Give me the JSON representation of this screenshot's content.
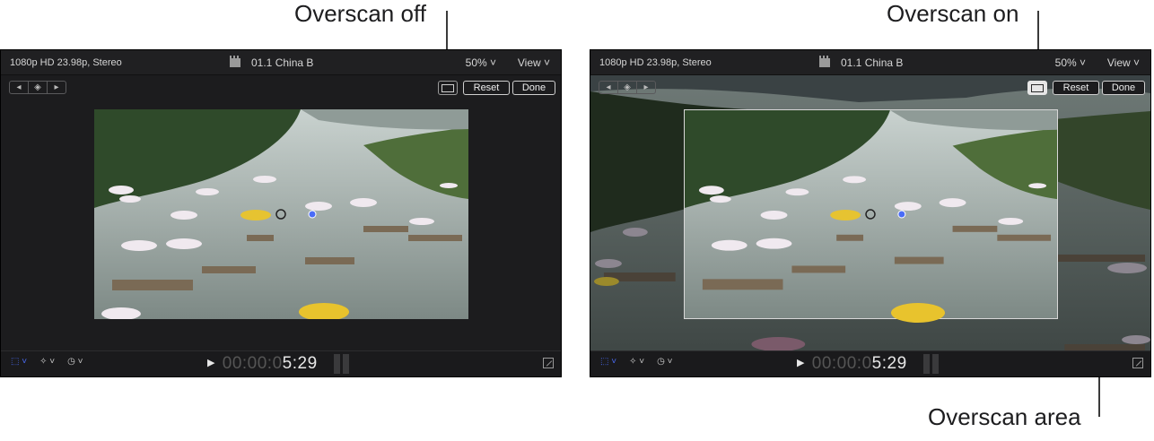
{
  "callouts": {
    "overscan_off": "Overscan off",
    "overscan_on": "Overscan on",
    "overscan_area": "Overscan area"
  },
  "viewer": {
    "format": "1080p HD 23.98p, Stereo",
    "clip_name": "01.1 China B",
    "zoom": "50% ˅",
    "view_menu": "View ˅",
    "reset_label": "Reset",
    "done_label": "Done",
    "keyframe_prev": "◂",
    "keyframe_add": "◈",
    "keyframe_next": "▸",
    "timecode_dim": "00:00:0",
    "timecode_bright": "5:29",
    "play_glyph": "▶",
    "tool_transform": "⬚ ˅",
    "tool_enhance": "✧ ˅",
    "tool_speed": "◷ ˅"
  },
  "icons": {
    "overscan": "overscan-icon",
    "clapper": "clapperboard-icon",
    "expand": "expand-icon"
  },
  "colors": {
    "viewer_bg": "#1c1c1e",
    "accent_blue": "#4a6cf7",
    "overscan_border": "#d8d8d8"
  }
}
